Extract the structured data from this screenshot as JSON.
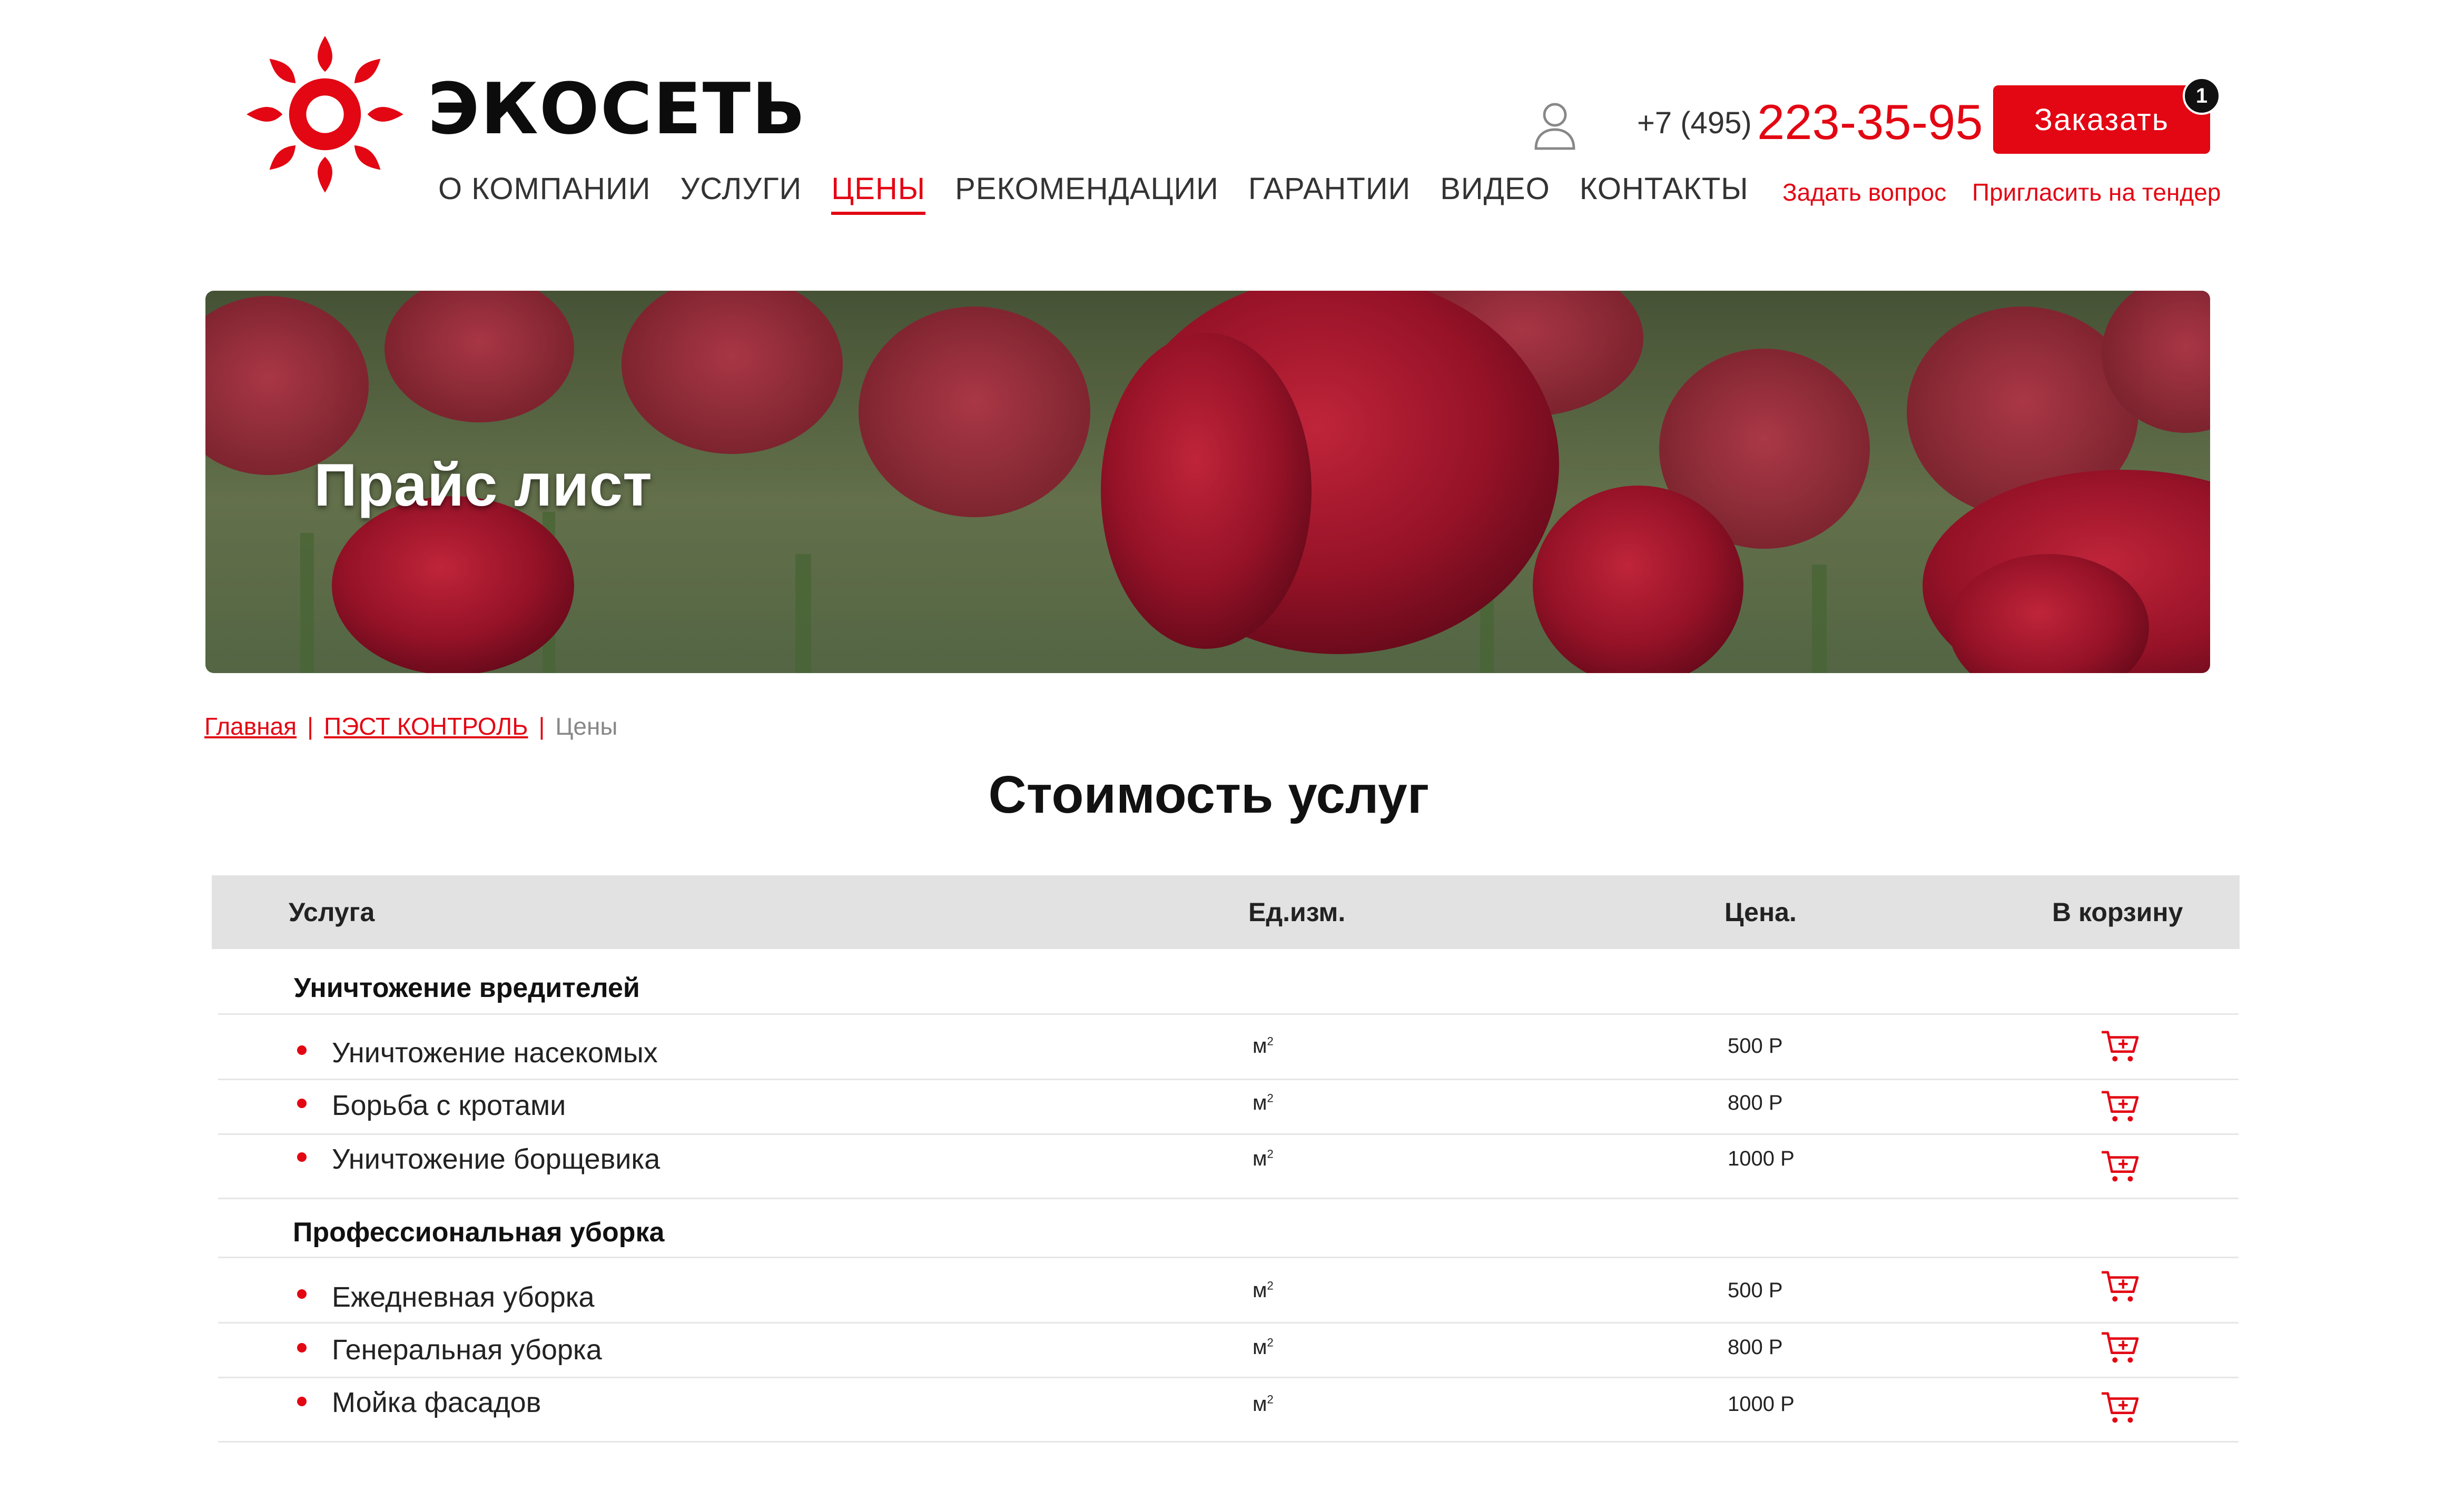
{
  "brand": {
    "name": "ЭКОСЕТЬ",
    "color": "#e30613"
  },
  "nav": [
    {
      "label": "О КОМПАНИИ"
    },
    {
      "label": "УСЛУГИ"
    },
    {
      "label": "ЦЕНЫ",
      "active": true
    },
    {
      "label": "РЕКОМЕНДАЦИИ"
    },
    {
      "label": "ГАРАНТИИ"
    },
    {
      "label": "ВИДЕО"
    },
    {
      "label": "КОНТАКТЫ"
    }
  ],
  "header": {
    "user_icon": "user-icon",
    "phone_prefix": "+7 (495)",
    "phone_main": "223-35-95",
    "order_label": "Заказать",
    "order_badge": "1",
    "ask_link": "Задать вопрос",
    "tender_link": "Пригласить на тендер"
  },
  "banner": {
    "title": "Прайс лист"
  },
  "breadcrumb": {
    "home": "Главная",
    "sep": "|",
    "section": "ПЭСТ КОНТРОЛЬ",
    "current": "Цены"
  },
  "main": {
    "title": "Стоимость услуг",
    "table": {
      "headers": {
        "service": "Услуга",
        "unit": "Ед.изм.",
        "price": "Цена.",
        "cart": "В корзину"
      },
      "groups": [
        {
          "title": "Уничтожение вредителей",
          "rows": [
            {
              "name": "Уничтожение насекомых",
              "unit": "м",
              "unit_sup": "2",
              "price": "500 Р"
            },
            {
              "name": "Борьба с кротами",
              "unit": "м",
              "unit_sup": "2",
              "price": "800 Р"
            },
            {
              "name": "Уничтожение борщевика",
              "unit": "м",
              "unit_sup": "2",
              "price": "1000 Р"
            }
          ]
        },
        {
          "title": "Профессиональная уборка",
          "rows": [
            {
              "name": "Ежедневная уборка",
              "unit": "м",
              "unit_sup": "2",
              "price": "500 Р"
            },
            {
              "name": "Генеральная уборка",
              "unit": "м",
              "unit_sup": "2",
              "price": "800 Р"
            },
            {
              "name": "Мойка фасадов",
              "unit": "м",
              "unit_sup": "2",
              "price": "1000 Р"
            }
          ]
        }
      ],
      "cart_icon": "add-to-cart-icon"
    }
  }
}
